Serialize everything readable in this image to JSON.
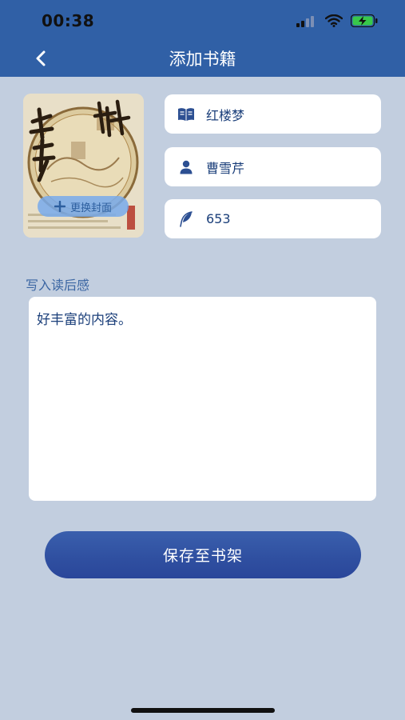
{
  "status_bar": {
    "time": "00:38"
  },
  "nav": {
    "title": "添加书籍"
  },
  "cover": {
    "change_label": "更换封面"
  },
  "fields": {
    "book_name": "红楼梦",
    "author": "曹雪芹",
    "pages": "653"
  },
  "review": {
    "label": "写入读后感",
    "text": "好丰富的内容。"
  },
  "save_button": {
    "label": "保存至书架"
  },
  "colors": {
    "primary": "#3060a6",
    "background": "#c2cedf",
    "accent_text": "#1b3f7a"
  }
}
